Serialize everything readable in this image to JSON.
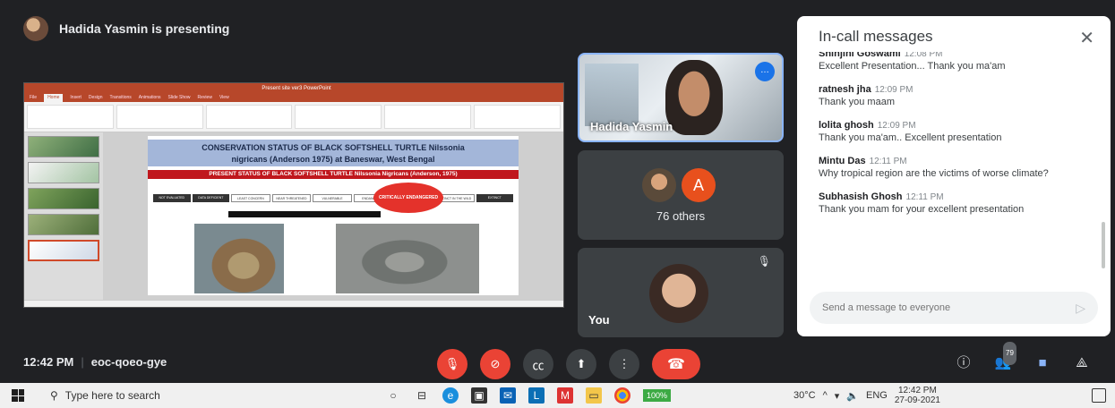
{
  "presenter_bar": {
    "text": "Hadida Yasmin is presenting"
  },
  "slide": {
    "app_title": "Present site ver3 PowerPoint",
    "ribbon_tabs": [
      "File",
      "Home",
      "Insert",
      "Design",
      "Transitions",
      "Animations",
      "Slide Show",
      "Review",
      "View"
    ],
    "title_line1": "CONSERVATION STATUS OF BLACK SOFTSHELL TURTLE Nilssonia",
    "title_line2": "nigricans (Anderson 1975) at Baneswar, West Bengal",
    "subtitle": "PRESENT STATUS OF BLACK SOFTSHELL TURTLE Nilssonia Nigricans (Anderson, 1975)",
    "status_labels": [
      "NOT EVALUATED",
      "DATA DEFICIENT",
      "LEAST CONCERN",
      "NEAR THREATENED",
      "VULNERABLE",
      "ENDANGERED",
      "CRITICALLY ENDANGERED",
      "EXTINCT IN THE WILD",
      "EXTINCT"
    ],
    "badge": "CRITICALLY ENDANGERED"
  },
  "tiles": {
    "presenter_name": "Hadida Yasmin",
    "speaking_icon": "…",
    "others_letter": "A",
    "others_label": "76 others",
    "you_label": "You"
  },
  "chat": {
    "title": "In-call messages",
    "close": "✕",
    "messages": [
      {
        "sender": "Shinjini Goswami",
        "time": "12:08 PM",
        "text": "Excellent Presentation... Thank you ma'am"
      },
      {
        "sender": "ratnesh jha",
        "time": "12:09 PM",
        "text": "Thank you maam"
      },
      {
        "sender": "lolita ghosh",
        "time": "12:09 PM",
        "text": "Thank you ma'am.. Excellent presentation"
      },
      {
        "sender": "Mintu Das",
        "time": "12:11 PM",
        "text": "Why tropical region are the victims of worse climate?"
      },
      {
        "sender": "Subhasish Ghosh",
        "time": "12:11 PM",
        "text": "Thank you mam for your excellent presentation"
      }
    ],
    "input_placeholder": "Send a message to everyone",
    "send_icon": "▷"
  },
  "meet_bar": {
    "time": "12:42 PM",
    "separator": "|",
    "meeting_code": "eoc-qoeo-gye",
    "people_count": "79"
  },
  "taskbar": {
    "search_placeholder": "Type here to search",
    "zoom_label": "100%",
    "temperature": "30°C",
    "language": "ENG",
    "clock_time": "12:42 PM",
    "clock_date": "27-09-2021"
  }
}
